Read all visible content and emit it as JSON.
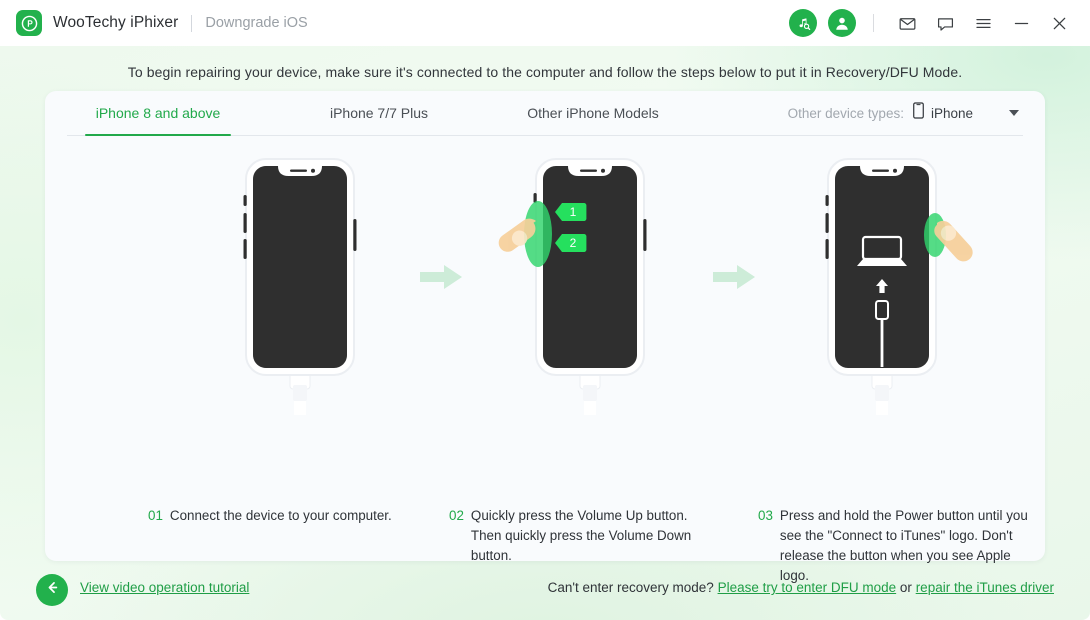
{
  "window": {
    "brand": "WooTechy iPhixer",
    "module": "Downgrade iOS",
    "logo_icon": "wootechy-p-logo-icon",
    "accent_green": "#22b14c",
    "link_green": "#1f9e46",
    "controls": [
      {
        "name": "itunes-tool-icon",
        "glyph": "music-search"
      },
      {
        "name": "user-account-icon",
        "glyph": "user"
      },
      {
        "name": "mail-icon",
        "glyph": "envelope"
      },
      {
        "name": "feedback-icon",
        "glyph": "chat-bubble"
      },
      {
        "name": "menu-icon",
        "glyph": "hamburger"
      },
      {
        "name": "minimize-button",
        "glyph": "minus"
      },
      {
        "name": "close-button",
        "glyph": "cross"
      }
    ]
  },
  "intro": {
    "text": "To begin repairing your device, make sure it's connected to the computer and follow the steps below to put it in Recovery/DFU Mode."
  },
  "tabs": {
    "items": [
      {
        "label": "iPhone 8 and above",
        "active": true
      },
      {
        "label": "iPhone 7/7 Plus",
        "active": false
      },
      {
        "label": "Other iPhone Models",
        "active": false
      }
    ],
    "device_types": {
      "label": "Other device types:",
      "value": "iPhone",
      "icon": "phone-outline-icon",
      "caret": "chevron-down-icon"
    }
  },
  "steps": [
    {
      "number": "01",
      "text": "Connect the device to your computer.",
      "illustration": "iphone-connected-to-cable"
    },
    {
      "number": "02",
      "text": "Quickly press the Volume Up button. Then quickly press the Volume Down button.",
      "illustration": "iphone-volume-buttons-press",
      "badges": [
        "1",
        "2"
      ]
    },
    {
      "number": "03",
      "text": "Press and hold the Power button until you see the \"Connect to iTunes\" logo. Don't release the button when you see Apple logo.",
      "illustration": "iphone-recovery-connect-to-itunes"
    }
  ],
  "footer": {
    "back_icon": "arrow-left-icon",
    "tutorial_link": "View video operation tutorial",
    "help_prefix": "Can't enter recovery mode?",
    "dfu_link": "Please try to enter DFU mode",
    "or_text": "or",
    "itunes_link": "repair the iTunes driver"
  }
}
